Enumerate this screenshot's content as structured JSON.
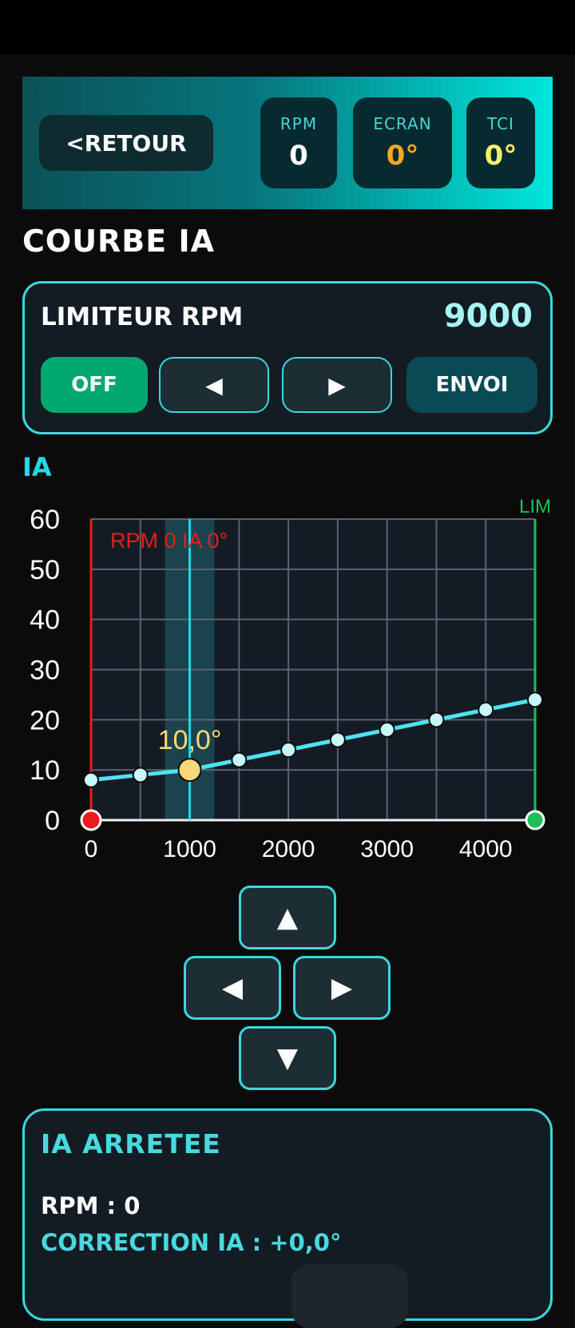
{
  "header": {
    "back_label": "<RETOUR",
    "stats": [
      {
        "label": "RPM",
        "value": "0",
        "color": "#ffffff"
      },
      {
        "label": "ECRAN",
        "value": "0°",
        "color": "#f5a623"
      },
      {
        "label": "TCI",
        "value": "0°",
        "color": "#f6f06b"
      }
    ]
  },
  "page_title": "COURBE IA",
  "limiter": {
    "title": "LIMITEUR RPM",
    "value": "9000",
    "off_label": "OFF",
    "left_label": "◀",
    "right_label": "▶",
    "send_label": "ENVOI"
  },
  "curve_label": "IA",
  "chart_data": {
    "type": "line",
    "x": [
      0,
      500,
      1000,
      1500,
      2000,
      2500,
      3000,
      3500,
      4000,
      4500
    ],
    "y": [
      8,
      9,
      10,
      12,
      14,
      16,
      18,
      20,
      22,
      24
    ],
    "selected_index": 2,
    "selected_label": "10,0°",
    "cursor_label": "RPM 0  IA 0°",
    "limit_label": "LIM",
    "xlim": [
      0,
      4500
    ],
    "ylim": [
      0,
      60
    ],
    "x_ticks": [
      "0",
      "1000",
      "2000",
      "3000",
      "4000"
    ],
    "y_ticks": [
      "60",
      "50",
      "40",
      "30",
      "20",
      "10",
      "0"
    ],
    "grid": true,
    "line_color": "#4ee3ee",
    "selected_color": "#fdd77a",
    "cursor_color": "#e81c1c",
    "limit_color": "#1fbf55"
  },
  "dpad": {
    "up": "▲",
    "left": "◀",
    "right": "▶",
    "down": "▼"
  },
  "status": {
    "title": "IA ARRETEE",
    "rpm": "RPM : 0",
    "correction": "CORRECTION IA : +0,0°"
  }
}
